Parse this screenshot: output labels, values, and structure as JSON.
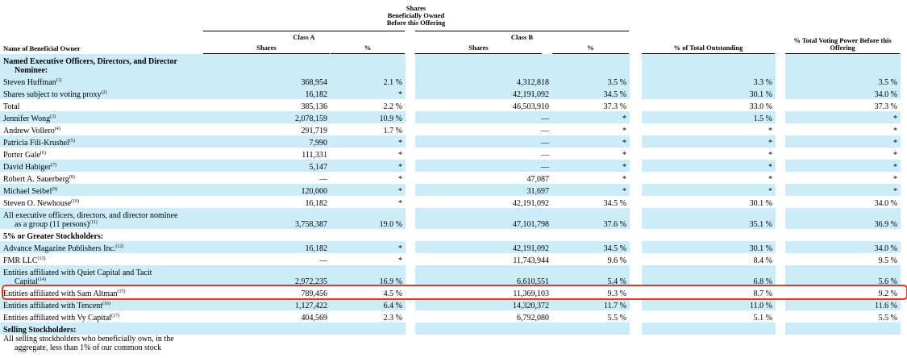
{
  "header": {
    "super_title_line1": "Shares",
    "super_title_line2": "Beneficially Owned",
    "super_title_line3": "Before this Offering",
    "class_a": "Class A",
    "class_b": "Class B",
    "col_owner": "Name of Beneficial Owner",
    "col_a_shares": "Shares",
    "col_a_pct": "%",
    "col_b_shares": "Shares",
    "col_b_pct": "%",
    "col_total": "% of Total Outstanding",
    "col_voting_line1": "% Total Voting Power Before this",
    "col_voting_line2": "Offering"
  },
  "rows": [
    {
      "name": "Named Executive Officers, Directors, and Director",
      "name2": "Nominee:",
      "sup": "",
      "a_shares": "",
      "a_pct": "",
      "b_shares": "",
      "b_pct": "",
      "total": "",
      "voting": ""
    },
    {
      "name": "Steven Huffman",
      "sup": "(1)",
      "a_shares": "368,954",
      "a_pct": "2.1 %",
      "b_shares": "4,312,818",
      "b_pct": "3.5 %",
      "total": "3.3 %",
      "voting": "3.5 %"
    },
    {
      "name": "Shares subject to voting proxy",
      "sup": "(2)",
      "a_shares": "16,182",
      "a_pct": "*",
      "b_shares": "42,191,092",
      "b_pct": "34.5 %",
      "total": "30.1 %",
      "voting": "34.0 %"
    },
    {
      "name": "Total",
      "sup": "",
      "a_shares": "385,136",
      "a_pct": "2.2 %",
      "b_shares": "46,503,910",
      "b_pct": "37.3 %",
      "total": "33.0 %",
      "voting": "37.3 %"
    },
    {
      "name": "Jennifer Wong",
      "sup": "(3)",
      "a_shares": "2,078,159",
      "a_pct": "10.9 %",
      "b_shares": "—",
      "b_pct": "*",
      "total": "1.5 %",
      "voting": "*"
    },
    {
      "name": "Andrew Vollero",
      "sup": "(4)",
      "a_shares": "291,719",
      "a_pct": "1.7 %",
      "b_shares": "—",
      "b_pct": "*",
      "total": "*",
      "voting": "*"
    },
    {
      "name": "Patricia Fili-Krushel",
      "sup": "(5)",
      "a_shares": "7,990",
      "a_pct": "*",
      "b_shares": "—",
      "b_pct": "*",
      "total": "*",
      "voting": "*"
    },
    {
      "name": "Porter Gale",
      "sup": "(6)",
      "a_shares": "111,331",
      "a_pct": "*",
      "b_shares": "—",
      "b_pct": "*",
      "total": "*",
      "voting": "*"
    },
    {
      "name": "David Habiger",
      "sup": "(7)",
      "a_shares": "5,147",
      "a_pct": "*",
      "b_shares": "—",
      "b_pct": "*",
      "total": "*",
      "voting": "*"
    },
    {
      "name": "Robert A. Sauerberg",
      "sup": "(8)",
      "a_shares": "—",
      "a_pct": "*",
      "b_shares": "47,087",
      "b_pct": "*",
      "total": "*",
      "voting": "*"
    },
    {
      "name": "Michael Seibel",
      "sup": "(9)",
      "a_shares": "120,000",
      "a_pct": "*",
      "b_shares": "31,697",
      "b_pct": "*",
      "total": "*",
      "voting": "*"
    },
    {
      "name": "Steven O. Newhouse",
      "sup": "(10)",
      "a_shares": "16,182",
      "a_pct": "*",
      "b_shares": "42,191,092",
      "b_pct": "34.5 %",
      "total": "30.1 %",
      "voting": "34.0 %"
    },
    {
      "name": "All executive officers, directors, and director nominee",
      "name2": "as a group (11 persons)",
      "sup": "(11)",
      "a_shares": "3,758,387",
      "a_pct": "19.0 %",
      "b_shares": "47,101,798",
      "b_pct": "37.6 %",
      "total": "35.1 %",
      "voting": "36.9 %"
    },
    {
      "name": "5% or Greater Stockholders:",
      "sup": "",
      "a_shares": "",
      "a_pct": "",
      "b_shares": "",
      "b_pct": "",
      "total": "",
      "voting": ""
    },
    {
      "name": "Advance Magazine Publishers Inc.",
      "sup": "(12)",
      "a_shares": "16,182",
      "a_pct": "*",
      "b_shares": "42,191,092",
      "b_pct": "34.5 %",
      "total": "30.1 %",
      "voting": "34.0 %"
    },
    {
      "name": "FMR LLC",
      "sup": "(13)",
      "a_shares": "—",
      "a_pct": "*",
      "b_shares": "11,743,944",
      "b_pct": "9.6 %",
      "total": "8.4 %",
      "voting": "9.5 %"
    },
    {
      "name": "Entities affiliated with Quiet Capital and Tacit",
      "name2": "Capital",
      "sup": "(14)",
      "a_shares": "2,972,235",
      "a_pct": "16.9 %",
      "b_shares": "6,610,551",
      "b_pct": "5.4 %",
      "total": "6.8 %",
      "voting": "5.6 %"
    },
    {
      "name": "Entities affiliated with Sam Altman",
      "sup": "(15)",
      "a_shares": "789,456",
      "a_pct": "4.5 %",
      "b_shares": "11,369,103",
      "b_pct": "9.3 %",
      "total": "8.7 %",
      "voting": "9.2 %"
    },
    {
      "name": "Entities affiliated with Tencent",
      "sup": "(16)",
      "a_shares": "1,127,422",
      "a_pct": "6.4 %",
      "b_shares": "14,320,372",
      "b_pct": "11.7 %",
      "total": "11.0 %",
      "voting": "11.6 %"
    },
    {
      "name": "Entities affiliated with Vy Capital",
      "sup": "(17)",
      "a_shares": "404,569",
      "a_pct": "2.3 %",
      "b_shares": "6,792,080",
      "b_pct": "5.5 %",
      "total": "5.1 %",
      "voting": "5.5 %"
    },
    {
      "name": "Selling Stockholders:",
      "sup": "",
      "a_shares": "",
      "a_pct": "",
      "b_shares": "",
      "b_pct": "",
      "total": "",
      "voting": ""
    },
    {
      "name": "All selling stockholders who beneficially own, in the",
      "name2": "aggregate, less than 1% of our common stock",
      "sup": "",
      "a_shares": "",
      "a_pct": "",
      "b_shares": "",
      "b_pct": "",
      "total": "",
      "voting": ""
    }
  ],
  "colors": {
    "shade": "#ccecfa",
    "highlight": "#e0392b"
  }
}
